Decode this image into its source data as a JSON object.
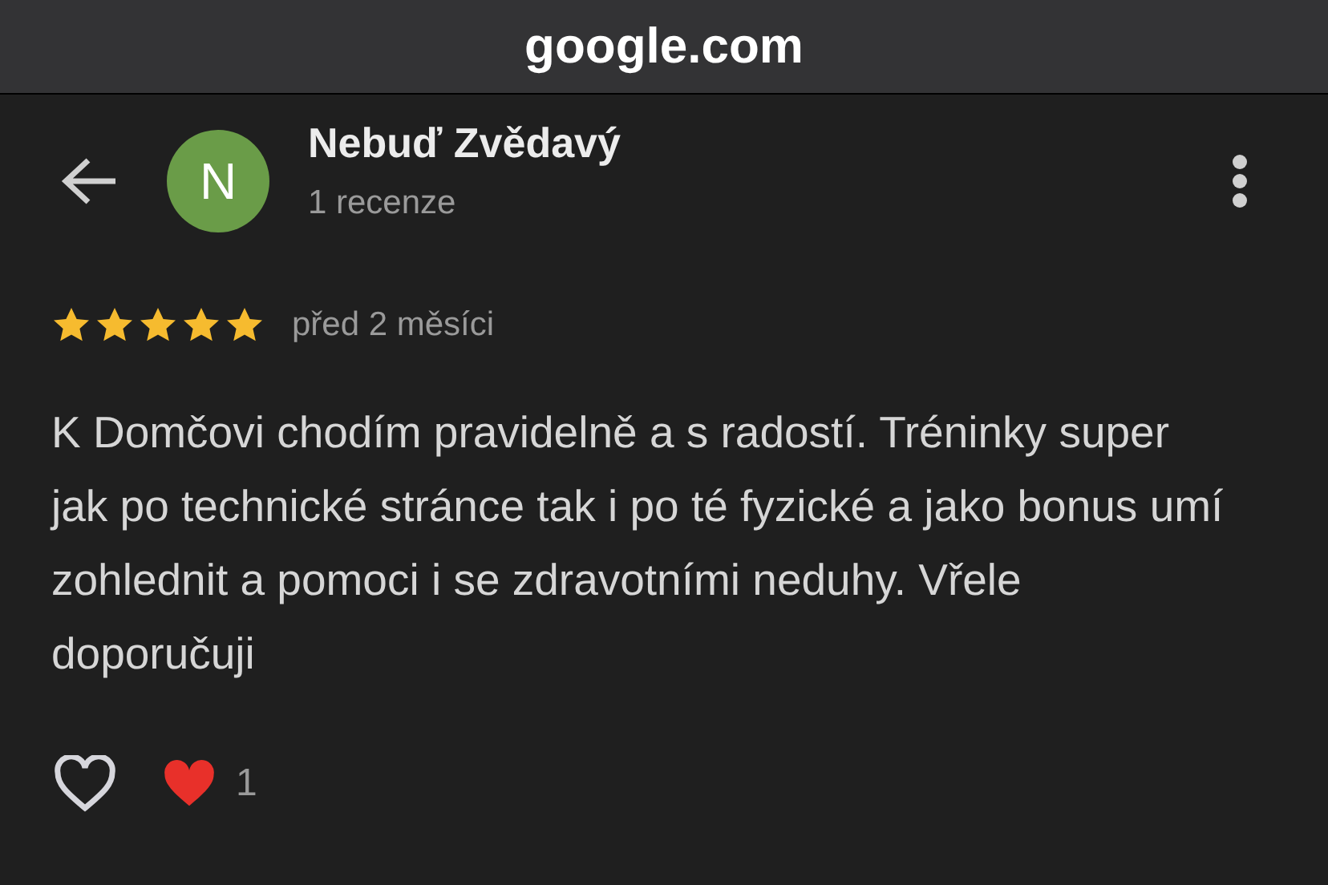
{
  "address_bar": {
    "domain": "google.com"
  },
  "reviewer": {
    "initial": "N",
    "color": "#6a9c48",
    "name": "Nebuď Zvědavý",
    "review_count": "1 recenze"
  },
  "review": {
    "stars": 5,
    "time": "před 2 měsíci",
    "text": "K Domčovi chodím pravidelně a s radostí. Tréninky super jak po technické stránce tak i po té fyzické a jako bonus umí zohlednit a pomoci i se zdravotními neduhy. Vřele doporučuji"
  },
  "reactions": {
    "liked": false,
    "count": "1"
  }
}
